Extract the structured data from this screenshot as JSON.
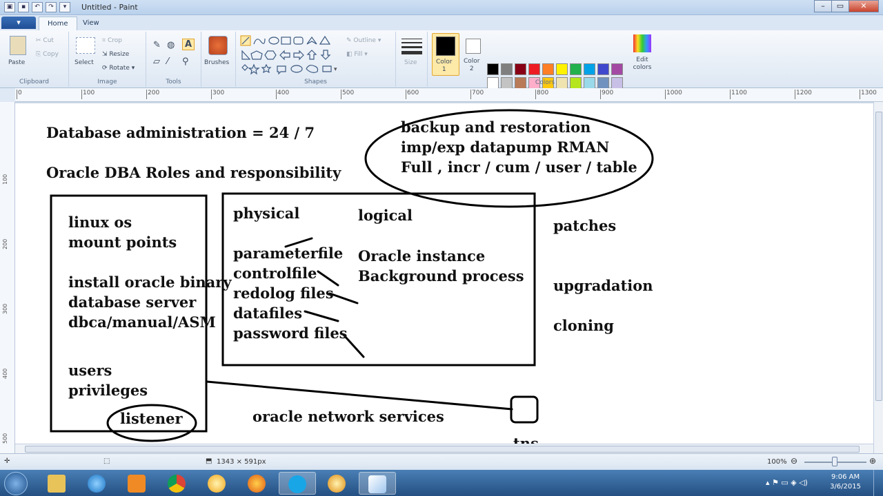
{
  "window": {
    "title": "Untitled - Paint",
    "controls": [
      "–",
      "▭",
      "✕"
    ]
  },
  "ribbon_tabs": {
    "file": "▾",
    "home": "Home",
    "view": "View"
  },
  "clipboard": {
    "paste": "Paste",
    "cut": "Cut",
    "copy": "Copy",
    "group": "Clipboard"
  },
  "image": {
    "select": "Select",
    "crop": "Crop",
    "resize": "Resize",
    "rotate": "Rotate",
    "group": "Image"
  },
  "tools": {
    "group": "Tools"
  },
  "brushes": {
    "label": "Brushes"
  },
  "shapes": {
    "outline": "Outline",
    "fill": "Fill",
    "group": "Shapes"
  },
  "size": {
    "label": "Size"
  },
  "color1": {
    "label": "Color\n1",
    "value": "#000000"
  },
  "color2": {
    "label": "Color\n2",
    "value": "#ffffff"
  },
  "colors": {
    "group": "Colors",
    "edit": "Edit colors",
    "row1": [
      "#000000",
      "#7f7f7f",
      "#880015",
      "#ed1c24",
      "#ff7f27",
      "#fff200",
      "#22b14c",
      "#00a2e8",
      "#3f48cc",
      "#a349a4"
    ],
    "row2": [
      "#ffffff",
      "#c3c3c3",
      "#b97a57",
      "#ffaec9",
      "#ffc90e",
      "#efe4b0",
      "#b5e61d",
      "#99d9ea",
      "#7092be",
      "#c8bfe7"
    ]
  },
  "ruler": {
    "ticks": [
      "0",
      "100",
      "200",
      "300",
      "400",
      "500",
      "600",
      "700",
      "800",
      "900",
      "1000",
      "1100",
      "1200",
      "1300"
    ]
  },
  "vruler": {
    "ticks": [
      "100",
      "200",
      "300",
      "400",
      "500"
    ]
  },
  "canvas_text": {
    "db_admin": "Database administration  = 24 / 7",
    "dba_roles": "Oracle DBA Roles and responsibility",
    "backup1": "backup and restoration",
    "backup2": "imp/exp datapump RMAN",
    "backup3": "Full , incr / cum / user / table",
    "linux": "linux os",
    "mount": "mount points",
    "install": "install oracle binary",
    "dbserver": "database server",
    "dbca": "dbca/manual/ASM",
    "users": "users",
    "privileges": "privileges",
    "listener": "listener",
    "physical": "physical",
    "logical": "logical",
    "paramfile": "parameterfile",
    "controlfile": "controlfile",
    "redolog": "redolog files",
    "datafiles": "datafiles",
    "password": "password files",
    "instance": "Oracle instance",
    "bgprocess": "Background process",
    "patches": "patches",
    "upgradation": "upgradation",
    "cloning": "cloning",
    "network": "oracle network services",
    "tns": "tns"
  },
  "status": {
    "dimensions": "1343 × 591px",
    "zoom": "100%"
  },
  "clock": {
    "time": "9:06 AM",
    "date": "3/6/2015"
  }
}
